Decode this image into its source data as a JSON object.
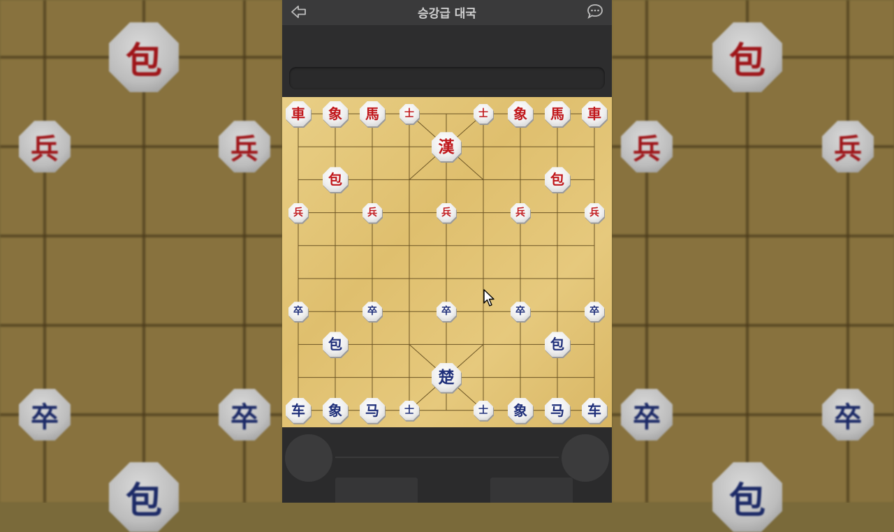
{
  "window": {
    "title": "승강급 대국"
  },
  "icons": {
    "back": "back-arrow-icon",
    "chat": "chat-bubble-icon",
    "cursor": "mouse-pointer-icon"
  },
  "colors": {
    "red_piece": "#c0171b",
    "blue_piece": "#1f2f7a",
    "board": "#e3c577",
    "chrome": "#2b2b2c"
  },
  "board": {
    "files": 9,
    "ranks": 10,
    "pieces": [
      {
        "side": "red",
        "char": "車",
        "file": 0,
        "rank": 0
      },
      {
        "side": "red",
        "char": "象",
        "file": 1,
        "rank": 0
      },
      {
        "side": "red",
        "char": "馬",
        "file": 2,
        "rank": 0
      },
      {
        "side": "red",
        "char": "士",
        "file": 3,
        "rank": 0,
        "size": "small"
      },
      {
        "side": "red",
        "char": "士",
        "file": 5,
        "rank": 0,
        "size": "small"
      },
      {
        "side": "red",
        "char": "象",
        "file": 6,
        "rank": 0
      },
      {
        "side": "red",
        "char": "馬",
        "file": 7,
        "rank": 0
      },
      {
        "side": "red",
        "char": "車",
        "file": 8,
        "rank": 0
      },
      {
        "side": "red",
        "char": "漢",
        "file": 4,
        "rank": 1,
        "size": "big"
      },
      {
        "side": "red",
        "char": "包",
        "file": 1,
        "rank": 2
      },
      {
        "side": "red",
        "char": "包",
        "file": 7,
        "rank": 2
      },
      {
        "side": "red",
        "char": "兵",
        "file": 0,
        "rank": 3,
        "size": "small"
      },
      {
        "side": "red",
        "char": "兵",
        "file": 2,
        "rank": 3,
        "size": "small"
      },
      {
        "side": "red",
        "char": "兵",
        "file": 4,
        "rank": 3,
        "size": "small"
      },
      {
        "side": "red",
        "char": "兵",
        "file": 6,
        "rank": 3,
        "size": "small"
      },
      {
        "side": "red",
        "char": "兵",
        "file": 8,
        "rank": 3,
        "size": "small"
      },
      {
        "side": "blue",
        "char": "卒",
        "file": 0,
        "rank": 6,
        "size": "small"
      },
      {
        "side": "blue",
        "char": "卒",
        "file": 2,
        "rank": 6,
        "size": "small"
      },
      {
        "side": "blue",
        "char": "卒",
        "file": 4,
        "rank": 6,
        "size": "small"
      },
      {
        "side": "blue",
        "char": "卒",
        "file": 6,
        "rank": 6,
        "size": "small"
      },
      {
        "side": "blue",
        "char": "卒",
        "file": 8,
        "rank": 6,
        "size": "small"
      },
      {
        "side": "blue",
        "char": "包",
        "file": 1,
        "rank": 7
      },
      {
        "side": "blue",
        "char": "包",
        "file": 7,
        "rank": 7
      },
      {
        "side": "blue",
        "char": "楚",
        "file": 4,
        "rank": 8,
        "size": "big"
      },
      {
        "side": "blue",
        "char": "车",
        "file": 0,
        "rank": 9
      },
      {
        "side": "blue",
        "char": "象",
        "file": 1,
        "rank": 9
      },
      {
        "side": "blue",
        "char": "马",
        "file": 2,
        "rank": 9
      },
      {
        "side": "blue",
        "char": "士",
        "file": 3,
        "rank": 9,
        "size": "small"
      },
      {
        "side": "blue",
        "char": "士",
        "file": 5,
        "rank": 9,
        "size": "small"
      },
      {
        "side": "blue",
        "char": "象",
        "file": 6,
        "rank": 9
      },
      {
        "side": "blue",
        "char": "马",
        "file": 7,
        "rank": 9
      },
      {
        "side": "blue",
        "char": "车",
        "file": 8,
        "rank": 9
      }
    ]
  },
  "background_pieces": [
    {
      "side": "red",
      "char": "包"
    },
    {
      "side": "red",
      "char": "兵"
    },
    {
      "side": "red",
      "char": "兵"
    },
    {
      "side": "blue",
      "char": "卒"
    },
    {
      "side": "blue",
      "char": "卒"
    },
    {
      "side": "blue",
      "char": "包"
    },
    {
      "side": "red",
      "char": "包"
    },
    {
      "side": "red",
      "char": "兵"
    },
    {
      "side": "red",
      "char": "兵"
    },
    {
      "side": "blue",
      "char": "卒"
    },
    {
      "side": "blue",
      "char": "卒"
    },
    {
      "side": "blue",
      "char": "包"
    }
  ]
}
